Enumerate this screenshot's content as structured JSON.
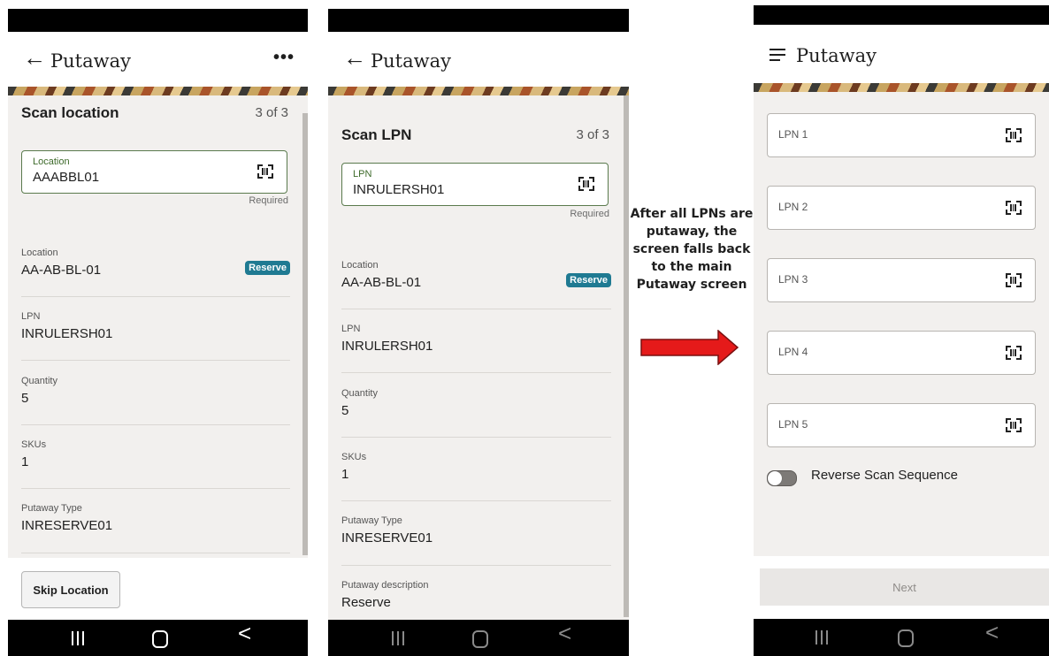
{
  "annotation": {
    "lines": [
      "After all LPNs are",
      "putaway, the",
      "screen falls back",
      "to the main",
      "Putaway screen"
    ]
  },
  "screen1": {
    "title": "Putaway",
    "back_glyph": "←",
    "menu_glyph": "•••",
    "heading": "Scan location",
    "counter": "3 of 3",
    "input": {
      "label": "Location",
      "value": "AAABBL01",
      "helper": "Required",
      "icon": "barcode-scan-icon"
    },
    "details": [
      {
        "label": "Location",
        "value": "AA-AB-BL-01",
        "badge": "Reserve"
      },
      {
        "label": "LPN",
        "value": "INRULERSH01"
      },
      {
        "label": "Quantity",
        "value": "5"
      },
      {
        "label": "SKUs",
        "value": "1"
      },
      {
        "label": "Putaway Type",
        "value": "INRESERVE01"
      }
    ],
    "skip_button": "Skip Location"
  },
  "screen2": {
    "title": "Putaway",
    "back_glyph": "←",
    "heading": "Scan LPN",
    "counter": "3 of 3",
    "input": {
      "label": "LPN",
      "value": "INRULERSH01",
      "helper": "Required",
      "icon": "barcode-scan-icon"
    },
    "details": [
      {
        "label": "Location",
        "value": "AA-AB-BL-01",
        "badge": "Reserve"
      },
      {
        "label": "LPN",
        "value": "INRULERSH01"
      },
      {
        "label": "Quantity",
        "value": "5"
      },
      {
        "label": "SKUs",
        "value": "1"
      },
      {
        "label": "Putaway Type",
        "value": "INRESERVE01"
      },
      {
        "label": "Putaway description",
        "value": "Reserve"
      }
    ]
  },
  "screen3": {
    "title": "Putaway",
    "lpn_fields": [
      {
        "placeholder": "LPN 1"
      },
      {
        "placeholder": "LPN 2"
      },
      {
        "placeholder": "LPN 3"
      },
      {
        "placeholder": "LPN 4"
      },
      {
        "placeholder": "LPN 5"
      }
    ],
    "toggle": {
      "label": "Reverse Scan Sequence",
      "on": false
    },
    "next_button": "Next"
  },
  "nav": {
    "back_glyph": "<"
  },
  "colors": {
    "accent_border": "#5a7a4d",
    "badge": "#1f7a92",
    "arrow": "#e51a1a"
  }
}
